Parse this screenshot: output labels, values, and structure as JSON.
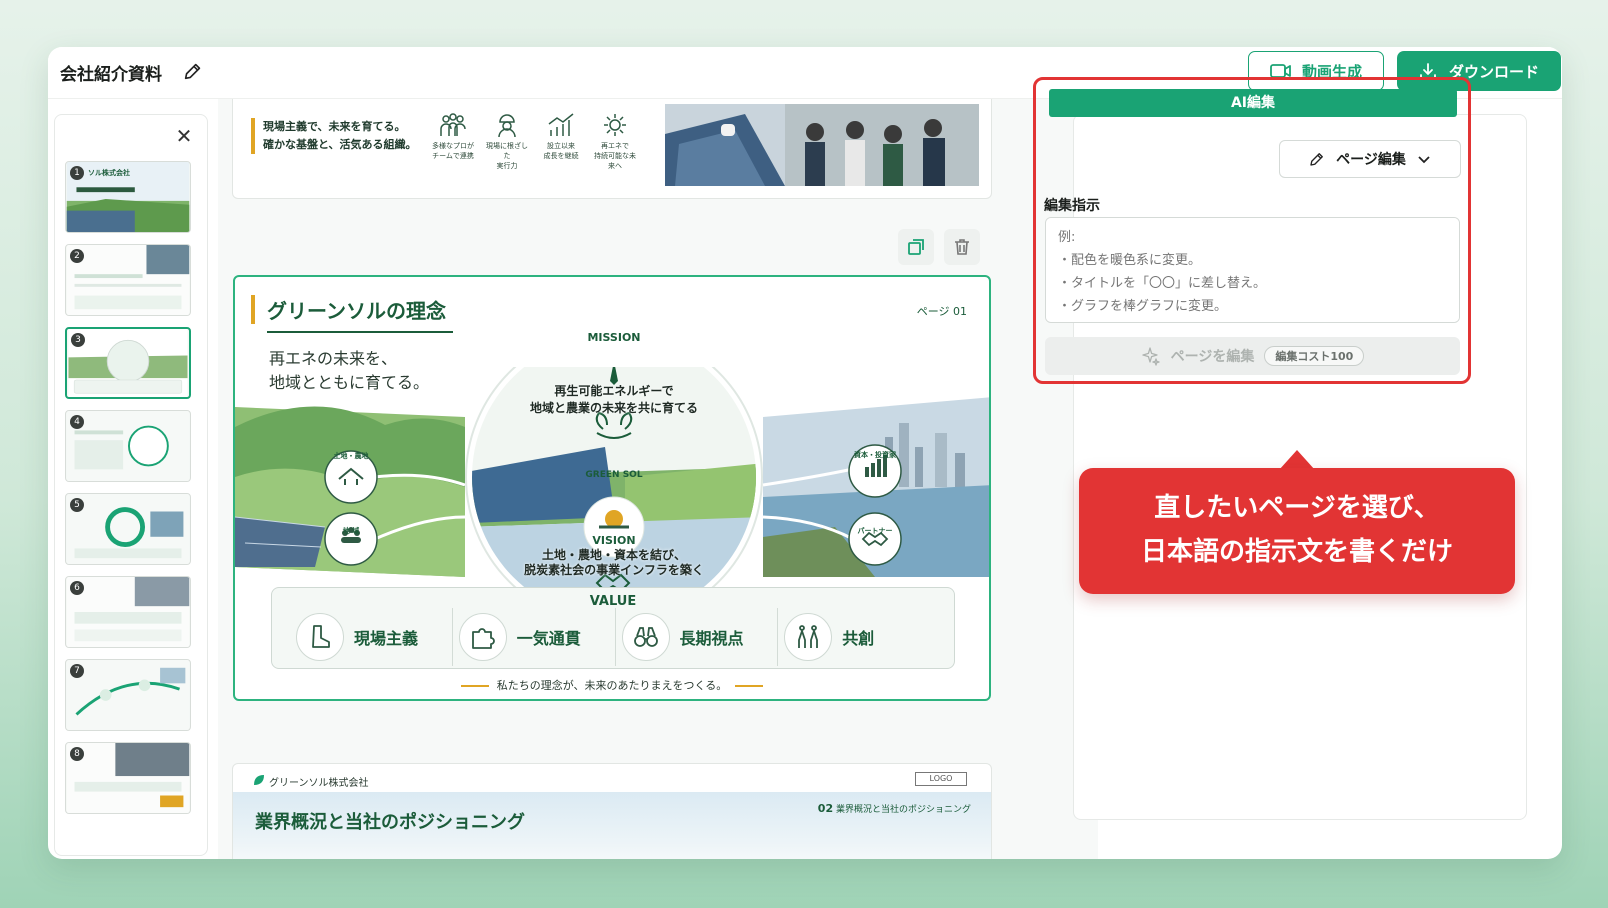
{
  "header": {
    "title": "会社紹介資料",
    "video_button": "動画生成",
    "download_button": "ダウンロード"
  },
  "thumbnails": {
    "items": [
      {
        "num": "1",
        "caption": "ソル株式会社"
      },
      {
        "num": "2",
        "caption": ""
      },
      {
        "num": "3",
        "caption": ""
      },
      {
        "num": "4",
        "caption": ""
      },
      {
        "num": "5",
        "caption": ""
      },
      {
        "num": "6",
        "caption": ""
      },
      {
        "num": "7",
        "caption": ""
      },
      {
        "num": "8",
        "caption": ""
      }
    ],
    "active": "3"
  },
  "prev_slide": {
    "line1": "現場主義で、未来を育てる。",
    "line2": "確かな基盤と、活気ある組織。",
    "icons": [
      {
        "label": "多様なプロが\nチームで連携"
      },
      {
        "label": "現場に根ざした\n実行力"
      },
      {
        "label": "設立以来\n成長を継続"
      },
      {
        "label": "再エネで\n持続可能な未来へ"
      }
    ]
  },
  "slide": {
    "title": "グリーンソルの理念",
    "page": "ページ 01",
    "subtitle_1": "再エネの未来を、",
    "subtitle_2": "地域とともに育てる。",
    "mission_label": "MISSION",
    "mission_1": "再生可能エネルギーで",
    "mission_2": "地域と農業の未来を共に育てる",
    "brand": "GREEN SOL",
    "vision_label": "VISION",
    "vision_1": "土地・農地・資本を結び、",
    "vision_2": "脱炭素社会の事業インフラを築く",
    "left_nodes": [
      "土地・農地",
      "地 域"
    ],
    "right_nodes": [
      "資本・投資家",
      "パートナー"
    ],
    "value_label": "VALUE",
    "values": [
      "現場主義",
      "一気通貫",
      "長期視点",
      "共創"
    ],
    "footer": "私たちの理念が、未来のあたりまえをつくる。"
  },
  "next_slide": {
    "company": "グリーンソル株式会社",
    "logo": "LOGO",
    "num": "02",
    "num_caption": "業界概況と当社のポジショニング",
    "title": "業界概況と当社のポジショニング"
  },
  "panel": {
    "ai_tab": "AI編集",
    "mode": "ページ編集",
    "instruction_label": "編集指示",
    "instruction_placeholder": "例:\n・配色を暖色系に変更。\n・タイトルを「〇〇」に差し替え。\n・グラフを棒グラフに変更。",
    "edit_button": "ページを編集",
    "cost": "編集コスト100"
  },
  "callout": {
    "line1": "直したいページを選び、",
    "line2": "日本語の指示文を書くだけ"
  },
  "colors": {
    "brand_green": "#1aa374",
    "deep_green": "#1b5c3a",
    "accent_gold": "#e0a524",
    "highlight_red": "#e23434"
  }
}
